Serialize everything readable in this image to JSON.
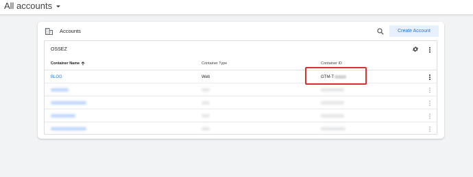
{
  "header": {
    "account_switcher_label": "All accounts"
  },
  "card": {
    "title": "Accounts",
    "create_button_label": "Create Account",
    "account": {
      "name": "OSSEZ",
      "columns": [
        "Container Name",
        "Container Type",
        "Container ID"
      ],
      "rows": [
        {
          "name": "BLOG",
          "type": "Web",
          "id": "GTM-T"
        }
      ],
      "obscured_row_count": 4
    }
  },
  "colors": {
    "accent": "#1a73e8",
    "create_button_bg": "#e8f0fe",
    "highlight_border": "#d6312f",
    "page_bg": "#f1f3f4"
  },
  "icons": [
    "caret-down-icon",
    "building-icon",
    "search-icon",
    "gear-icon",
    "more-vert-icon",
    "arrow-up-icon"
  ]
}
